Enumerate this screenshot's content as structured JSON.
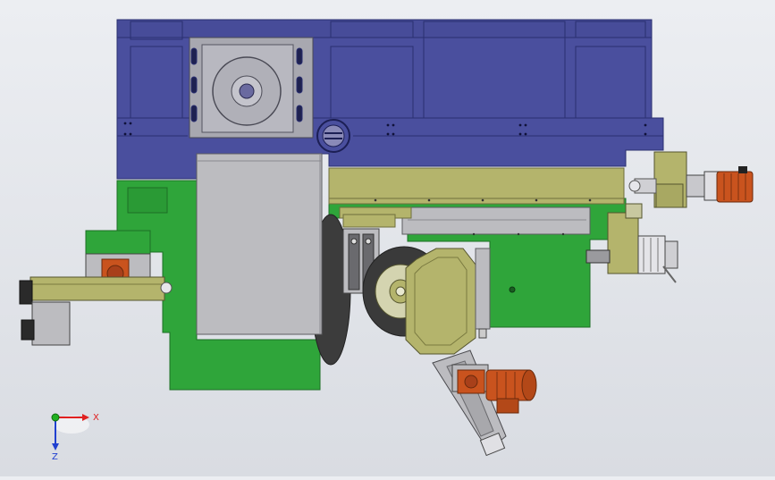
{
  "viewport": {
    "background_top": "#eceef2",
    "background_bottom": "#d9dce2"
  },
  "colors": {
    "frame_blue": "#4a4f9e",
    "frame_blue_dark": "#2a2f70",
    "machine_green": "#2fa53a",
    "green_dark": "#1d6e25",
    "olive": "#b4b46c",
    "olive_dark": "#6e6e3c",
    "steel": "#bcbcc0",
    "steel_dark": "#5c5c60",
    "motor_orange": "#c9531e",
    "motor_dark": "#6a2a0c",
    "blade_dark": "#3c3c3c"
  },
  "triad": {
    "x_label": "X",
    "z_label": "Z",
    "x_color": "#e02020",
    "y_color": "#20b020",
    "z_color": "#2040d0"
  }
}
